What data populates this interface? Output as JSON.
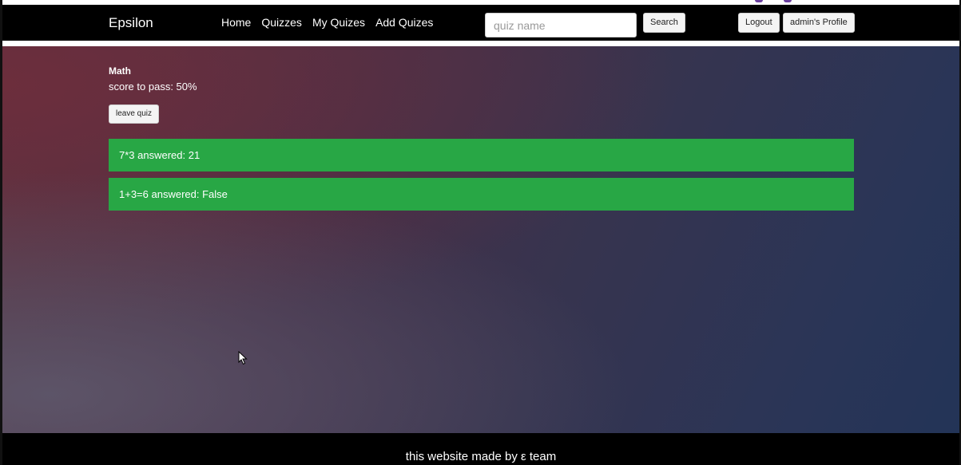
{
  "navbar": {
    "brand": "Epsilon",
    "links": [
      "Home",
      "Quizzes",
      "My Quizes",
      "Add Quizes"
    ],
    "search_placeholder": "quiz name",
    "search_label": "Search",
    "logout_label": "Logout",
    "profile_label": "admin's Profile"
  },
  "quiz": {
    "title": "Math",
    "score_to_pass": "score to pass: 50%",
    "leave_label": "leave quiz",
    "answers": [
      "7*3 answered: 21",
      "1+3=6 answered: False"
    ]
  },
  "footer": {
    "text": "this website made by ε team"
  },
  "colors": {
    "navbar": "#000000",
    "answer_correct": "#28a745",
    "text": "#ffffff"
  }
}
